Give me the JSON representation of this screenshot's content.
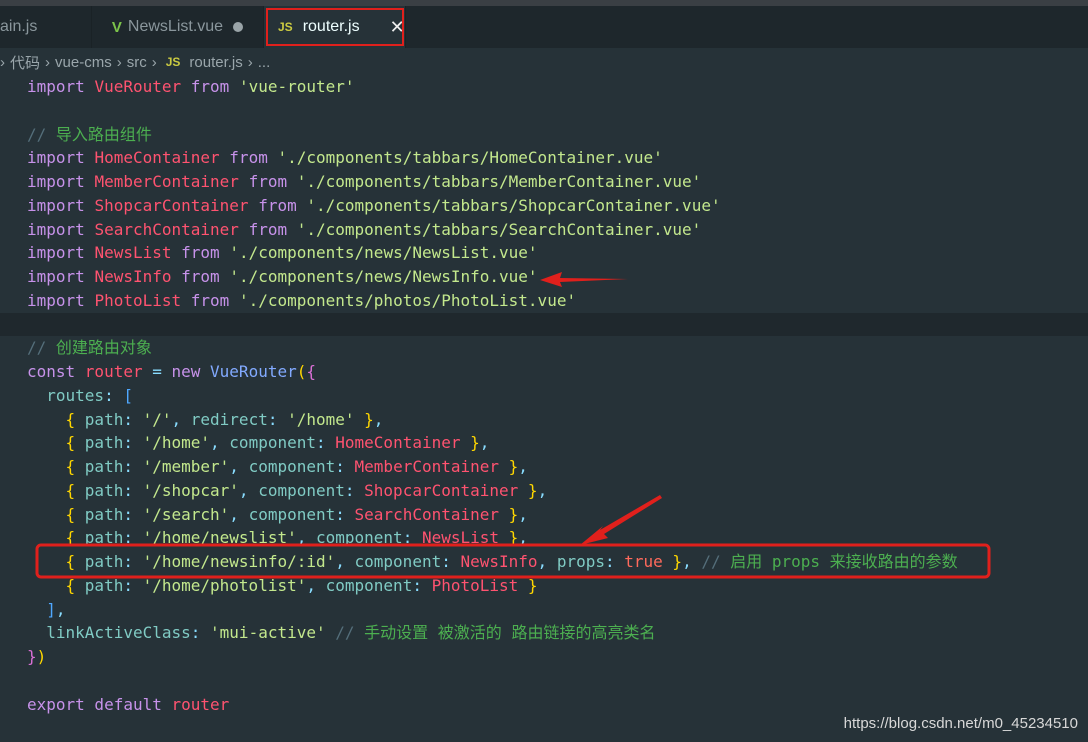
{
  "tabs": [
    {
      "label": "ain.js",
      "icon": "none"
    },
    {
      "label": "NewsList.vue",
      "icon": "vue-icon",
      "modified": true
    },
    {
      "label": "router.js",
      "icon": "js-icon",
      "active": true
    }
  ],
  "breadcrumb": [
    "代码",
    "vue-cms",
    "src",
    "router.js",
    "..."
  ],
  "breadcrumb_js_icon": "JS",
  "code": [
    [
      [
        "kw",
        "import "
      ],
      [
        "id",
        "VueRouter "
      ],
      [
        "kw",
        "from "
      ],
      [
        "str",
        "'vue-router'"
      ]
    ],
    [],
    [
      [
        "cms",
        "// "
      ],
      [
        "cm",
        "导入路由组件"
      ]
    ],
    [
      [
        "kw",
        "import "
      ],
      [
        "id",
        "HomeContainer "
      ],
      [
        "kw",
        "from "
      ],
      [
        "str",
        "'./components/tabbars/HomeContainer.vue'"
      ]
    ],
    [
      [
        "kw",
        "import "
      ],
      [
        "id",
        "MemberContainer "
      ],
      [
        "kw",
        "from "
      ],
      [
        "str",
        "'./components/tabbars/MemberContainer.vue'"
      ]
    ],
    [
      [
        "kw",
        "import "
      ],
      [
        "id",
        "ShopcarContainer "
      ],
      [
        "kw",
        "from "
      ],
      [
        "str",
        "'./components/tabbars/ShopcarContainer.vue'"
      ]
    ],
    [
      [
        "kw",
        "import "
      ],
      [
        "id",
        "SearchContainer "
      ],
      [
        "kw",
        "from "
      ],
      [
        "str",
        "'./components/tabbars/SearchContainer.vue'"
      ]
    ],
    [
      [
        "kw",
        "import "
      ],
      [
        "id",
        "NewsList "
      ],
      [
        "kw",
        "from "
      ],
      [
        "str",
        "'./components/news/NewsList.vue'"
      ]
    ],
    [
      [
        "kw",
        "import "
      ],
      [
        "id",
        "NewsInfo "
      ],
      [
        "kw",
        "from "
      ],
      [
        "str",
        "'./components/news/NewsInfo.vue'"
      ]
    ],
    [
      [
        "kw",
        "import "
      ],
      [
        "id",
        "PhotoList "
      ],
      [
        "kw",
        "from "
      ],
      [
        "str",
        "'./components/photos/PhotoList.vue'"
      ]
    ],
    [],
    [
      [
        "cms",
        "// "
      ],
      [
        "cm",
        "创建路由对象"
      ]
    ],
    [
      [
        "kw",
        "const "
      ],
      [
        "id",
        "router "
      ],
      [
        "pun",
        "= "
      ],
      [
        "kw",
        "new "
      ],
      [
        "fn",
        "VueRouter"
      ],
      [
        "b1",
        "("
      ],
      [
        "b2",
        "{"
      ]
    ],
    [
      [
        "pl",
        "  "
      ],
      [
        "prop",
        "routes"
      ],
      [
        "pun",
        ": "
      ],
      [
        "b3",
        "["
      ]
    ],
    [
      [
        "pl",
        "    "
      ],
      [
        "b1",
        "{ "
      ],
      [
        "prop",
        "path"
      ],
      [
        "pun",
        ": "
      ],
      [
        "str",
        "'/'"
      ],
      [
        "pun",
        ", "
      ],
      [
        "prop",
        "redirect"
      ],
      [
        "pun",
        ": "
      ],
      [
        "str",
        "'/home' "
      ],
      [
        "b1",
        "}"
      ],
      [
        "pun",
        ","
      ]
    ],
    [
      [
        "pl",
        "    "
      ],
      [
        "b1",
        "{ "
      ],
      [
        "prop",
        "path"
      ],
      [
        "pun",
        ": "
      ],
      [
        "str",
        "'/home'"
      ],
      [
        "pun",
        ", "
      ],
      [
        "prop",
        "component"
      ],
      [
        "pun",
        ": "
      ],
      [
        "id",
        "HomeContainer "
      ],
      [
        "b1",
        "}"
      ],
      [
        "pun",
        ","
      ]
    ],
    [
      [
        "pl",
        "    "
      ],
      [
        "b1",
        "{ "
      ],
      [
        "prop",
        "path"
      ],
      [
        "pun",
        ": "
      ],
      [
        "str",
        "'/member'"
      ],
      [
        "pun",
        ", "
      ],
      [
        "prop",
        "component"
      ],
      [
        "pun",
        ": "
      ],
      [
        "id",
        "MemberContainer "
      ],
      [
        "b1",
        "}"
      ],
      [
        "pun",
        ","
      ]
    ],
    [
      [
        "pl",
        "    "
      ],
      [
        "b1",
        "{ "
      ],
      [
        "prop",
        "path"
      ],
      [
        "pun",
        ": "
      ],
      [
        "str",
        "'/shopcar'"
      ],
      [
        "pun",
        ", "
      ],
      [
        "prop",
        "component"
      ],
      [
        "pun",
        ": "
      ],
      [
        "id",
        "ShopcarContainer "
      ],
      [
        "b1",
        "}"
      ],
      [
        "pun",
        ","
      ]
    ],
    [
      [
        "pl",
        "    "
      ],
      [
        "b1",
        "{ "
      ],
      [
        "prop",
        "path"
      ],
      [
        "pun",
        ": "
      ],
      [
        "str",
        "'/search'"
      ],
      [
        "pun",
        ", "
      ],
      [
        "prop",
        "component"
      ],
      [
        "pun",
        ": "
      ],
      [
        "id",
        "SearchContainer "
      ],
      [
        "b1",
        "}"
      ],
      [
        "pun",
        ","
      ]
    ],
    [
      [
        "pl",
        "    "
      ],
      [
        "b1",
        "{ "
      ],
      [
        "prop",
        "path"
      ],
      [
        "pun",
        ": "
      ],
      [
        "str",
        "'/home/newslist'"
      ],
      [
        "pun",
        ", "
      ],
      [
        "prop",
        "component"
      ],
      [
        "pun",
        ": "
      ],
      [
        "id",
        "NewsList "
      ],
      [
        "b1",
        "}"
      ],
      [
        "pun",
        ","
      ]
    ],
    [
      [
        "pl",
        "    "
      ],
      [
        "b1",
        "{ "
      ],
      [
        "prop",
        "path"
      ],
      [
        "pun",
        ": "
      ],
      [
        "str",
        "'/home/newsinfo/:id'"
      ],
      [
        "pun",
        ", "
      ],
      [
        "prop",
        "component"
      ],
      [
        "pun",
        ": "
      ],
      [
        "id",
        "NewsInfo"
      ],
      [
        "pun",
        ", "
      ],
      [
        "prop",
        "props"
      ],
      [
        "pun",
        ": "
      ],
      [
        "bool",
        "true "
      ],
      [
        "b1",
        "}"
      ],
      [
        "pun",
        ", "
      ],
      [
        "cms",
        "// "
      ],
      [
        "cm",
        "启用 props 来接收路由的参数"
      ]
    ],
    [
      [
        "pl",
        "    "
      ],
      [
        "b1",
        "{ "
      ],
      [
        "prop",
        "path"
      ],
      [
        "pun",
        ": "
      ],
      [
        "str",
        "'/home/photolist'"
      ],
      [
        "pun",
        ", "
      ],
      [
        "prop",
        "component"
      ],
      [
        "pun",
        ": "
      ],
      [
        "id",
        "PhotoList "
      ],
      [
        "b1",
        "}"
      ]
    ],
    [
      [
        "pl",
        "  "
      ],
      [
        "b3",
        "]"
      ],
      [
        "pun",
        ","
      ]
    ],
    [
      [
        "pl",
        "  "
      ],
      [
        "prop",
        "linkActiveClass"
      ],
      [
        "pun",
        ": "
      ],
      [
        "str",
        "'mui-active' "
      ],
      [
        "cms",
        "// "
      ],
      [
        "cm",
        "手动设置 被激活的 路由链接的高亮类名"
      ]
    ],
    [
      [
        "b2",
        "}"
      ],
      [
        "b1",
        ")"
      ]
    ],
    [],
    [
      [
        "kw",
        "export default "
      ],
      [
        "id",
        "router"
      ]
    ]
  ],
  "current_line": 11,
  "watermark": "https://blog.csdn.net/m0_45234510",
  "colors": {
    "background": "#263238",
    "annotation": "#e0201c"
  }
}
